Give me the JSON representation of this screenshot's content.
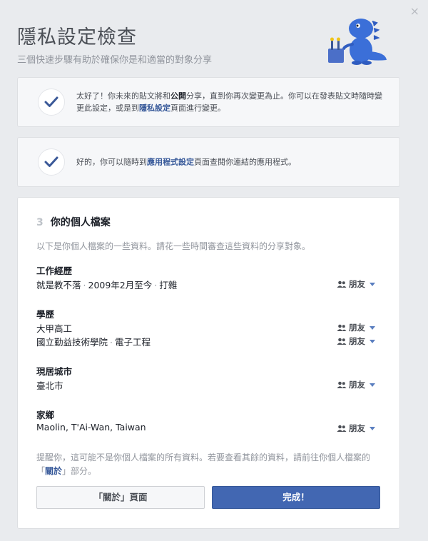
{
  "dialog": {
    "close_glyph": "×",
    "title": "隱私設定檢查",
    "subtitle": "三個快速步驟有助於確保你是和適當的對象分享"
  },
  "step1": {
    "text_a": "太好了！你未來的貼文將和",
    "text_b": "公開",
    "text_c": "分享，直到你再次變更為止。你可以在發表貼文時隨時變更此設定，或是到",
    "link": "隱私設定",
    "text_d": "頁面進行變更。"
  },
  "step2": {
    "text_a": "好的，你可以隨時到",
    "link": "應用程式設定",
    "text_b": "頁面查閱你連結的應用程式。"
  },
  "step3": {
    "number": "3",
    "title": "你的個人檔案",
    "intro": "以下是你個人檔案的一些資料。請花一些時間審查這些資料的分享對象。",
    "audience_label": "朋友",
    "sections": {
      "work": {
        "title": "工作經歷",
        "employer": "就是教不落",
        "period": "2009年2月至今",
        "role": "打雜"
      },
      "education": {
        "title": "學歷",
        "school1": "大甲高工",
        "school2": "國立勤益技術學院",
        "major2": "電子工程"
      },
      "current_city": {
        "title": "現居城市",
        "value": "臺北市"
      },
      "hometown": {
        "title": "家鄉",
        "value": "Maolin, T'Ai-Wan, Taiwan"
      }
    },
    "dot_sep": "·",
    "reminder_a": "提醒你，這可能不是你個人檔案的所有資料。若要查看其餘的資料，請前往你個人檔案的「",
    "reminder_link": "關於",
    "reminder_b": "」部分。",
    "about_button": "「關於」頁面",
    "done_button": "完成！"
  },
  "colors": {
    "accent": "#4267b2",
    "link": "#365899",
    "check": "#3b5998",
    "mascot": "#3b6fd8"
  },
  "icons": [
    "close-icon",
    "checkmark-icon",
    "friends-icon",
    "caret-down-icon",
    "dinosaur-mascot"
  ]
}
